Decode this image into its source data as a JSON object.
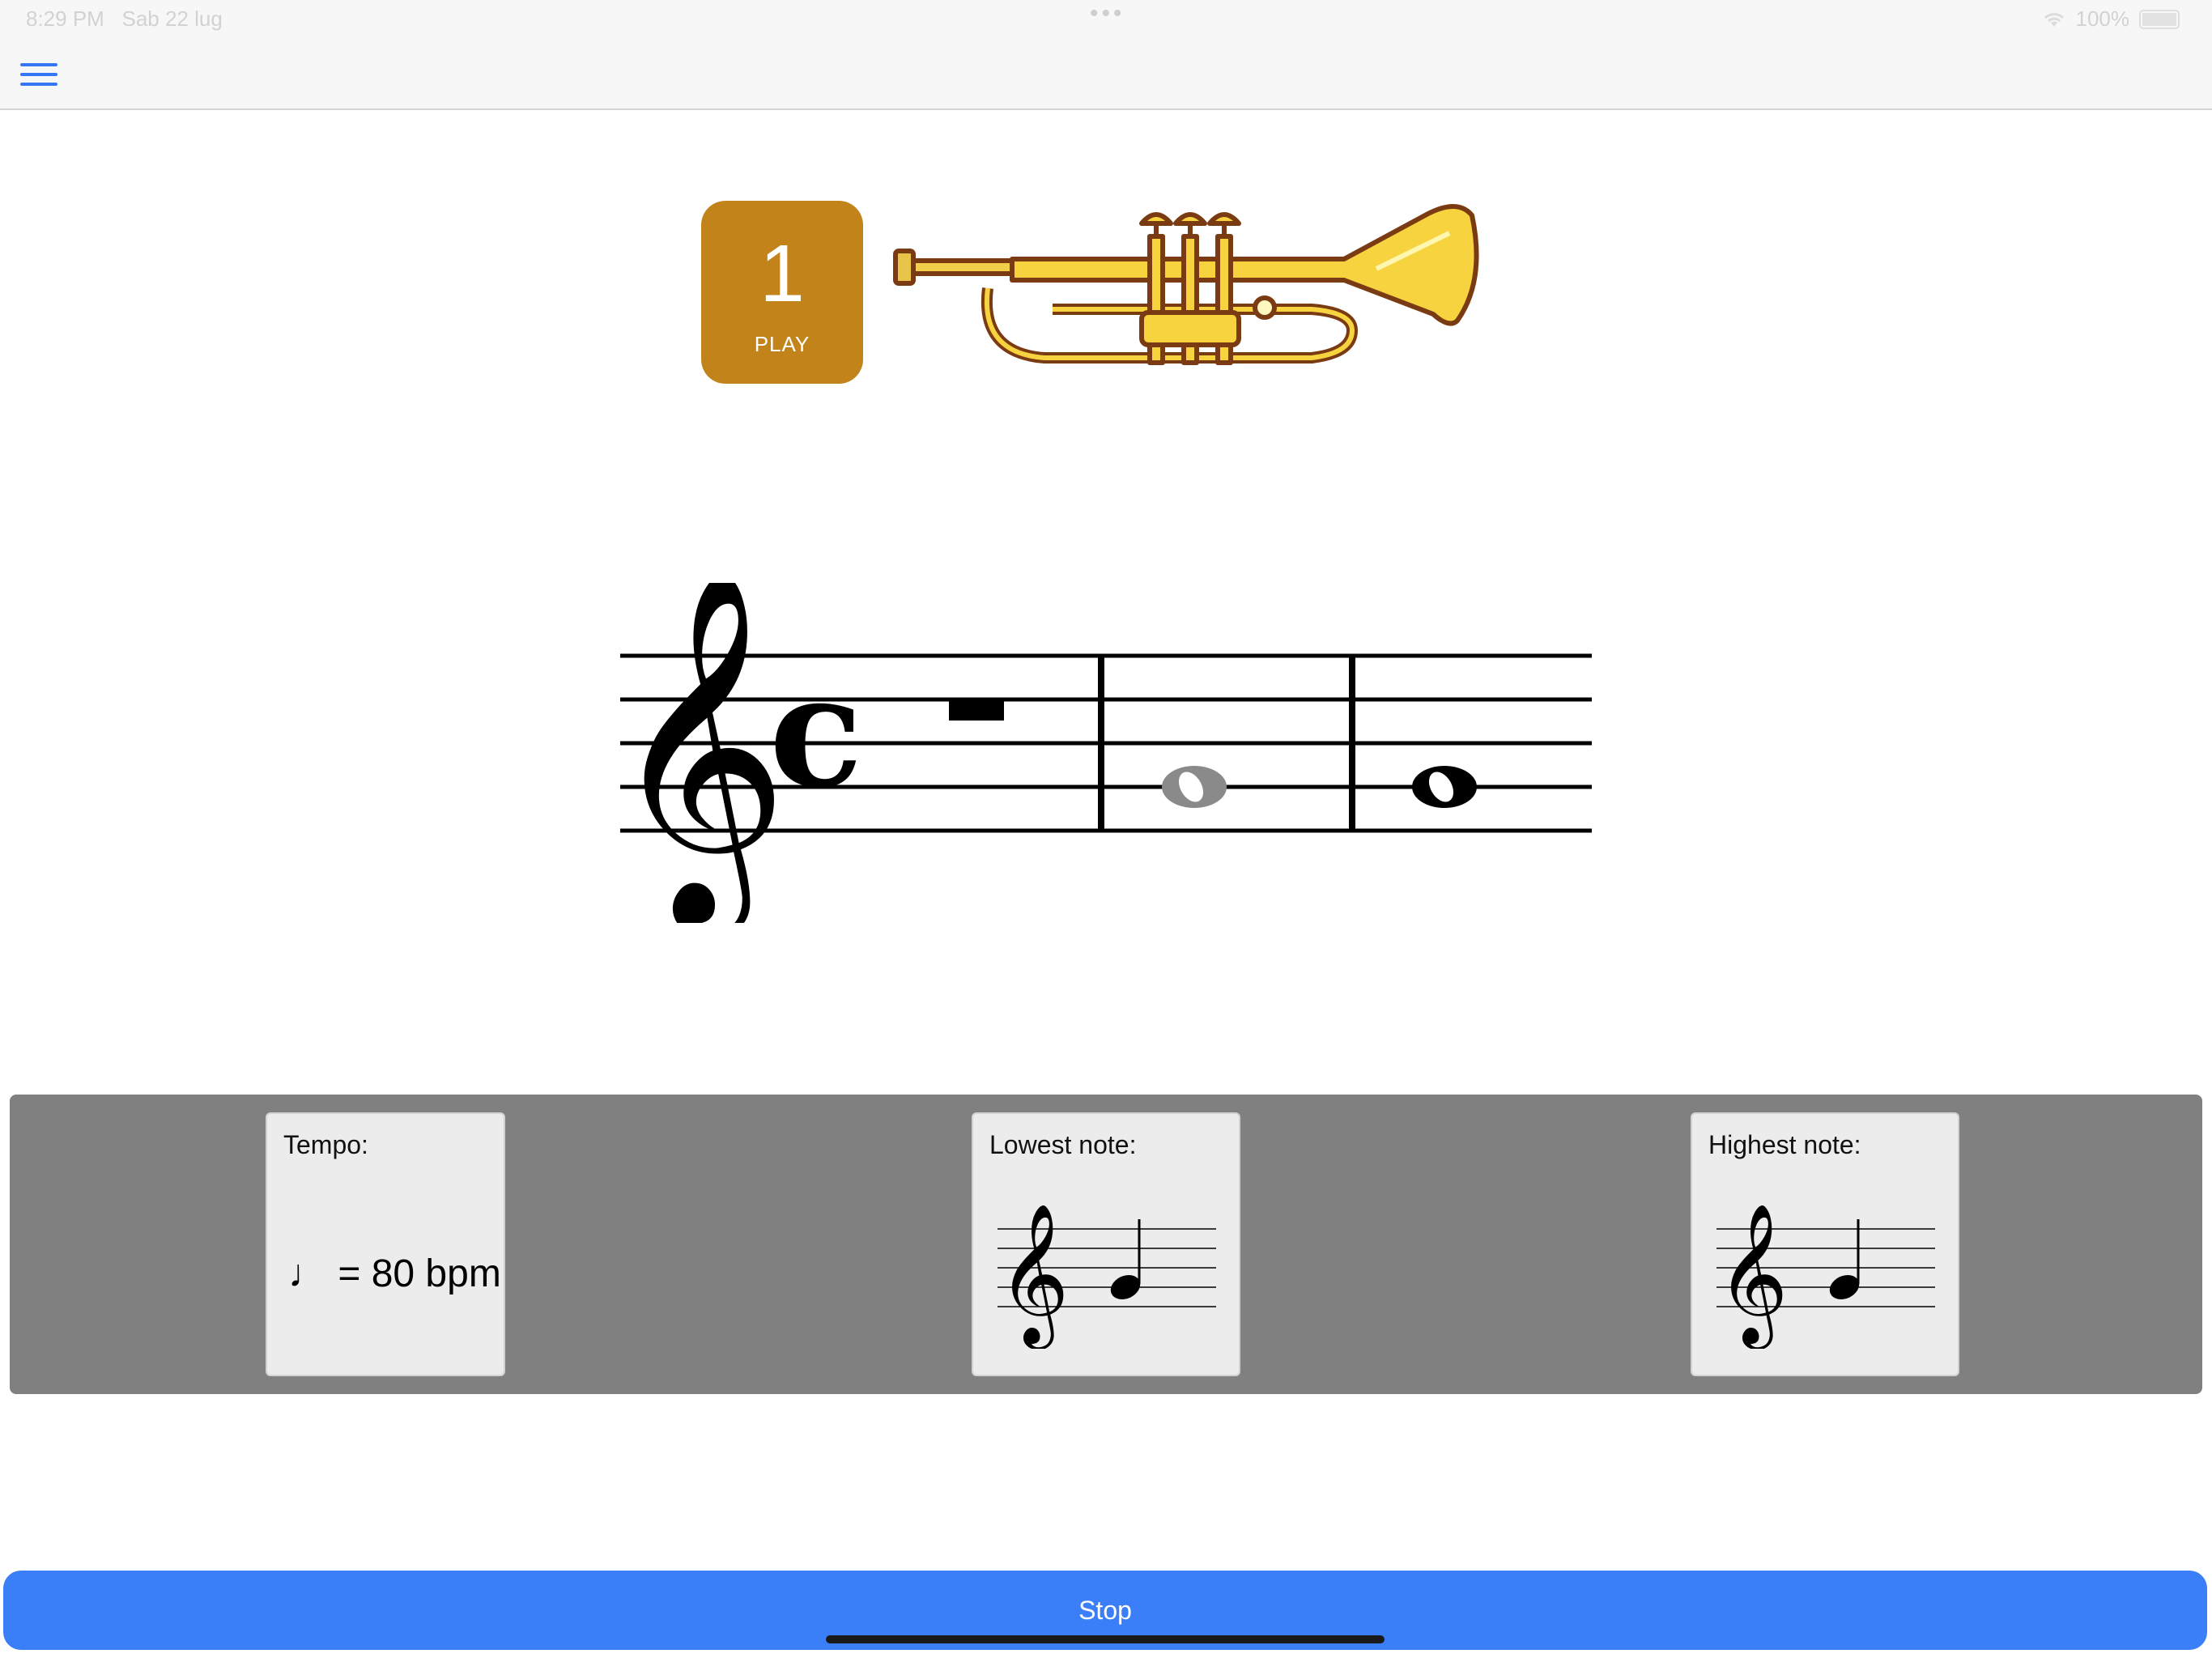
{
  "status_bar": {
    "time": "8:29 PM",
    "date": "Sab 22 lug",
    "battery": "100%",
    "multitask_dots": "•••"
  },
  "nav": {
    "menu_icon": "hamburger-menu-icon"
  },
  "count_in": {
    "number": "1",
    "label": "PLAY",
    "color": "#c2841a"
  },
  "instrument": {
    "icon": "trumpet-illustration"
  },
  "score": {
    "clef": "treble",
    "time_signature": "C",
    "measures": [
      {
        "content": "half-rest"
      },
      {
        "content": "whole-note",
        "pitch": "G4",
        "state": "played"
      },
      {
        "content": "whole-note",
        "pitch": "G4",
        "state": "current"
      }
    ]
  },
  "settings": {
    "tempo": {
      "title": "Tempo:",
      "value": "♩ = 80 bpm"
    },
    "lowest_note": {
      "title": "Lowest note:",
      "pitch": "G4"
    },
    "highest_note": {
      "title": "Highest note:",
      "pitch": "G4"
    }
  },
  "actions": {
    "stop_label": "Stop",
    "accent_color": "#3a7ef8"
  }
}
